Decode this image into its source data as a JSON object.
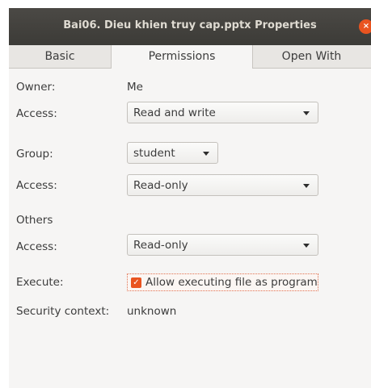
{
  "window": {
    "title": "Bai06. Dieu khien truy cap.pptx Properties",
    "close_glyph": "×"
  },
  "tabs": [
    {
      "label": "Basic"
    },
    {
      "label": "Permissions"
    },
    {
      "label": "Open With"
    }
  ],
  "owner": {
    "label": "Owner:",
    "value": "Me",
    "access_label": "Access:",
    "access_value": "Read and write"
  },
  "group": {
    "label": "Group:",
    "value": "student",
    "access_label": "Access:",
    "access_value": "Read-only"
  },
  "others": {
    "label": "Others",
    "access_label": "Access:",
    "access_value": "Read-only"
  },
  "execute": {
    "label": "Execute:",
    "checkbox_label": "Allow executing file as program",
    "checked": true
  },
  "security": {
    "label": "Security context:",
    "value": "unknown"
  },
  "colors": {
    "accent": "#e95420",
    "titlebar": "#3c3b37"
  },
  "icons": {
    "close": "close-icon",
    "dropdown": "chevron-down-icon",
    "checkbox": "checkmark-icon"
  }
}
